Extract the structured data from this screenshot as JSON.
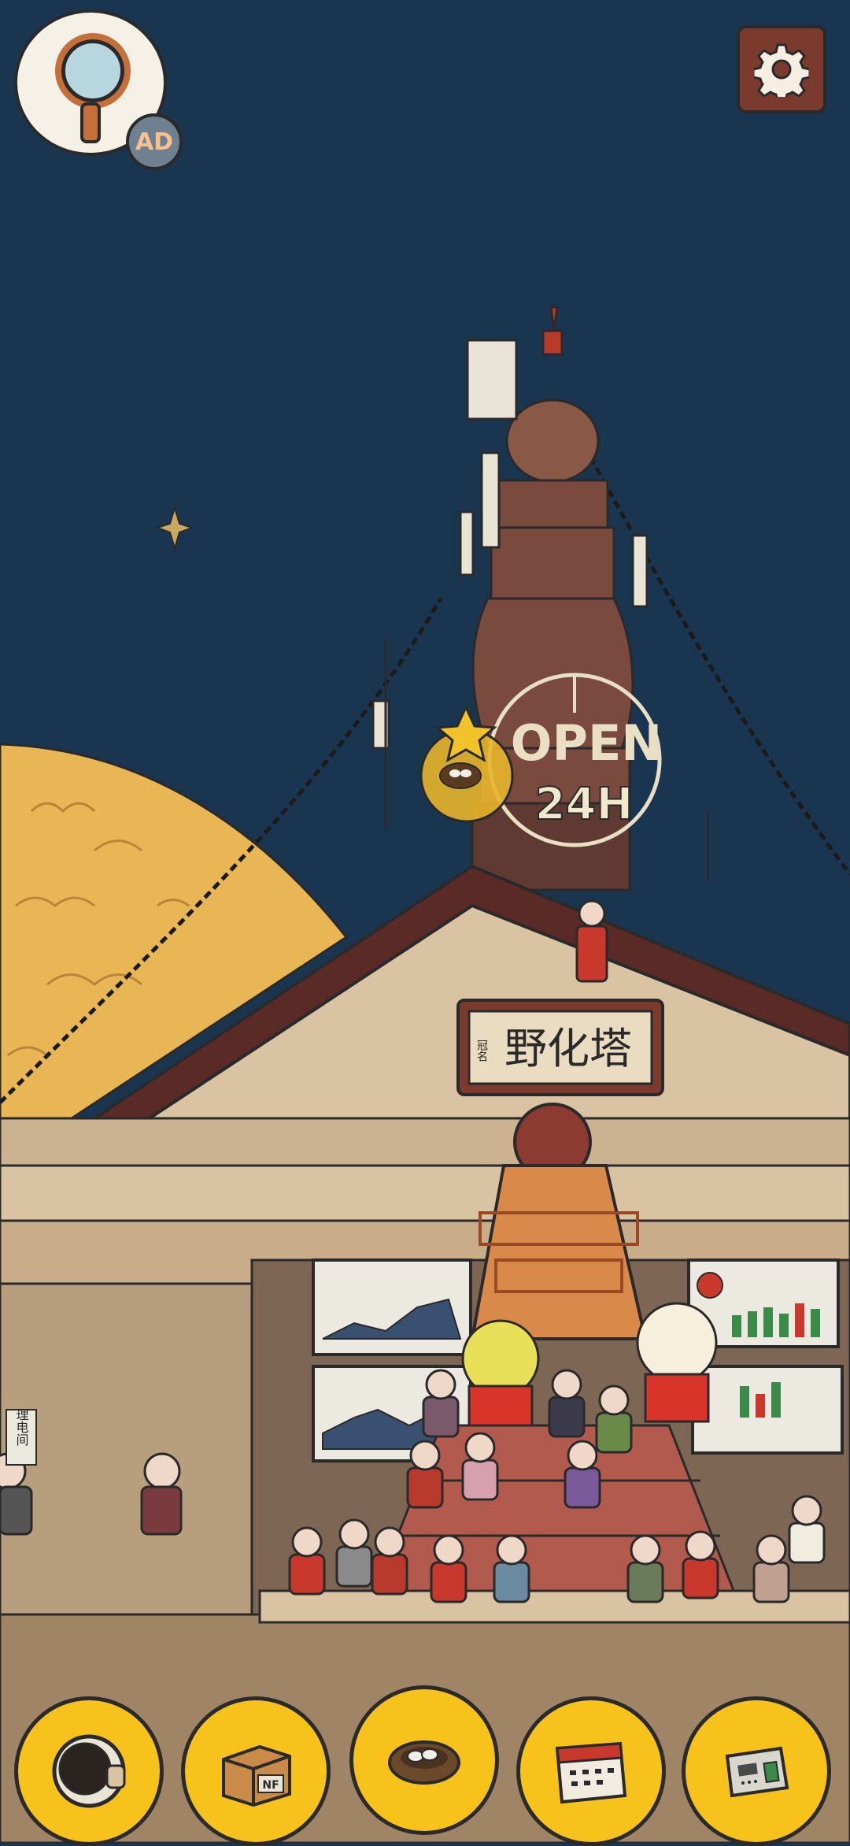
{
  "hud": {
    "ad_badge_label": "AD",
    "settings_icon": "gear-icon",
    "magnifier_icon": "magnifier-icon"
  },
  "scene": {
    "tower_sign_top": "OPEN",
    "tower_sign_bottom": "24H",
    "plaque_text": "野化塔",
    "plaque_small": "冠名",
    "door_sign": "理电间"
  },
  "dock": {
    "items": [
      {
        "icon": "astronaut-helmet-icon"
      },
      {
        "icon": "nft-box-icon",
        "label": "NF"
      },
      {
        "icon": "bird-nest-icon"
      },
      {
        "icon": "calendar-icon"
      },
      {
        "icon": "safe-icon"
      }
    ]
  },
  "colors": {
    "sky": "#1a3550",
    "moon": "#e8b654",
    "tower": "#7a4a3f",
    "roof": "#5a2a26",
    "wood": "#d9c3a3",
    "dock_button": "#f7c21c"
  }
}
